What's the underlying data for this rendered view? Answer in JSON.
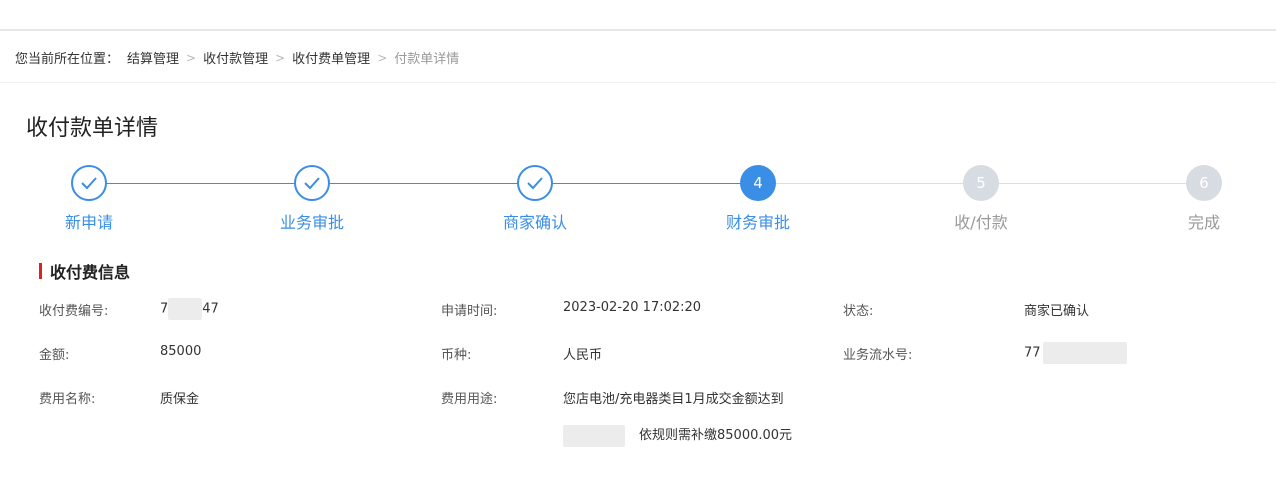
{
  "breadcrumb": {
    "prefix": "您当前所在位置：",
    "items": [
      "结算管理",
      "收付款管理",
      "收付费单管理"
    ],
    "current": "付款单详情"
  },
  "page": {
    "title": "收付款单详情"
  },
  "steps": [
    {
      "label": "新申请",
      "status": "done"
    },
    {
      "label": "业务审批",
      "status": "done"
    },
    {
      "label": "商家确认",
      "status": "done"
    },
    {
      "label": "财务审批",
      "status": "active",
      "number": "4"
    },
    {
      "label": "收/付款",
      "status": "todo",
      "number": "5"
    },
    {
      "label": "完成",
      "status": "todo",
      "number": "6"
    }
  ],
  "section": {
    "title": "收付费信息"
  },
  "info": {
    "code_label": "收付费编号:",
    "code_prefix": "7",
    "code_suffix": "47",
    "apply_time_label": "申请时间:",
    "apply_time": "2023-02-20 17:02:20",
    "status_label": "状态:",
    "status": "商家已确认",
    "amount_label": "金额:",
    "amount": "85000",
    "currency_label": "币种:",
    "currency": "人民币",
    "serial_label": "业务流水号:",
    "serial_prefix": "77",
    "fee_name_label": "费用名称:",
    "fee_name": "质保金",
    "fee_use_label": "费用用途:",
    "fee_use_line1": "您店电池/充电器类目1月成交金额达到",
    "fee_use_line2": "依规则需补缴85000.00元"
  },
  "colors": {
    "primary": "#3a8ee6",
    "accent_bar": "#e02020",
    "todo_circle": "#d7dbe2"
  }
}
